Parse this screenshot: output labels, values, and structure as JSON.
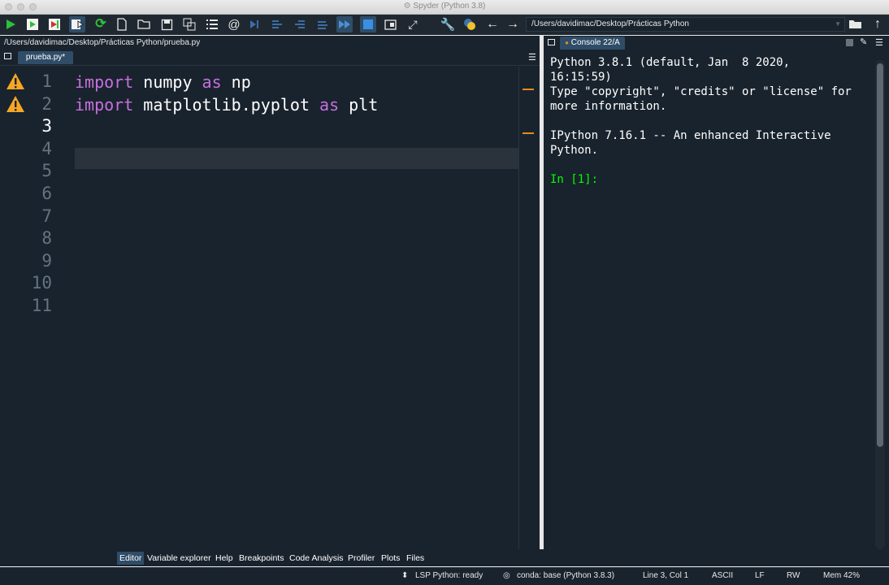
{
  "window": {
    "title": "Spyder (Python 3.8)"
  },
  "toolbar": {
    "path": "/Users/davidimac/Desktop/Prácticas Python",
    "icons": [
      "run-icon",
      "run-cell-icon",
      "run-cell-advance-icon",
      "run-selection-icon",
      "rerun-icon",
      "new-file-icon",
      "open-file-icon",
      "save-icon",
      "save-all-icon",
      "outline-icon",
      "at-icon",
      "step-icon",
      "step-into-icon",
      "step-return-icon",
      "continue-icon",
      "fast-forward-icon",
      "stop-icon",
      "maximize-pane-icon",
      "fullscreen-icon",
      "preferences-icon",
      "python-path-icon",
      "back-icon",
      "forward-icon",
      "browse-folder-icon",
      "parent-directory-icon"
    ]
  },
  "editor": {
    "file_path": "/Users/davidimac/Desktop/Prácticas Python/prueba.py",
    "tab_label": "prueba.py*",
    "line_numbers": [
      "1",
      "2",
      "3",
      "4",
      "5",
      "6",
      "7",
      "8",
      "9",
      "10",
      "11"
    ],
    "current_line": 3,
    "line1": {
      "kw1": "import",
      "mod": " numpy ",
      "kw2": "as",
      "alias": " np"
    },
    "line2": {
      "kw1": "import",
      "mod": " matplotlib.pyplot ",
      "kw2": "as",
      "alias": " plt"
    },
    "warnings_on_lines": [
      1,
      2
    ],
    "warning_color": "#f5a623"
  },
  "console": {
    "tab_label": "Console 22/A",
    "lines": [
      "Python 3.8.1 (default, Jan  8 2020,",
      "16:15:59)",
      "Type \"copyright\", \"credits\" or \"license\" for",
      "more information.",
      "",
      "IPython 7.16.1 -- An enhanced Interactive",
      "Python.",
      ""
    ],
    "prompt": "In [1]:",
    "prompt_color": "#00ff00"
  },
  "bottom_tabs": [
    "Editor",
    "Variable explorer",
    "Help",
    "Breakpoints",
    "Code Analysis",
    "Profiler",
    "Plots",
    "Files"
  ],
  "active_bottom_tab": "Editor",
  "status": {
    "lsp": "LSP Python: ready",
    "conda": "conda: base (Python 3.8.3)",
    "position": "Line 3, Col 1",
    "encoding": "ASCII",
    "eol": "LF",
    "mode": "RW",
    "memory": "Mem 42%"
  },
  "colors": {
    "background": "#19232d",
    "keyword": "#c670e0",
    "accent": "#2f4d68"
  }
}
